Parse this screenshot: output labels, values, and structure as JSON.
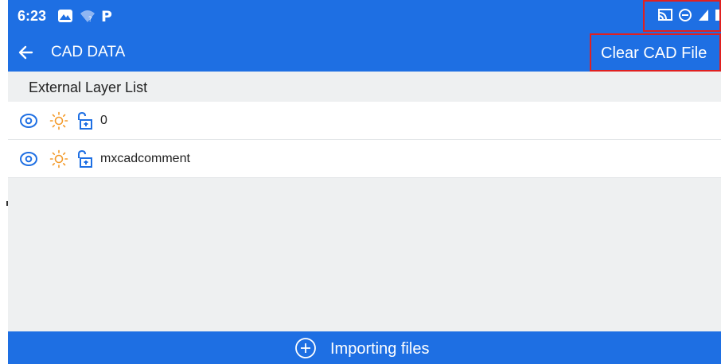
{
  "status_bar": {
    "time": "6:23",
    "left_icons": [
      "photos-icon",
      "wifi-question-icon",
      "parking-icon"
    ],
    "right_icons": [
      "cast-icon",
      "do-not-disturb-icon",
      "signal-icon",
      "battery-icon"
    ]
  },
  "app_bar": {
    "title": "CAD DATA",
    "action_label": "Clear CAD File"
  },
  "layer_list": {
    "header": "External Layer List",
    "layers": [
      {
        "name": "0",
        "icons": [
          "eye-icon",
          "sun-icon",
          "unlock-icon"
        ]
      },
      {
        "name": "mxcadcomment",
        "icons": [
          "eye-icon",
          "sun-icon",
          "unlock-icon"
        ]
      }
    ]
  },
  "bottom_bar": {
    "label": "Importing files",
    "icon": "add-circle-icon"
  },
  "colors": {
    "primary": "#1e6fe3",
    "sun": "#f39a2a",
    "icon_blue": "#1e6fe3",
    "highlight_box": "#e02020"
  }
}
